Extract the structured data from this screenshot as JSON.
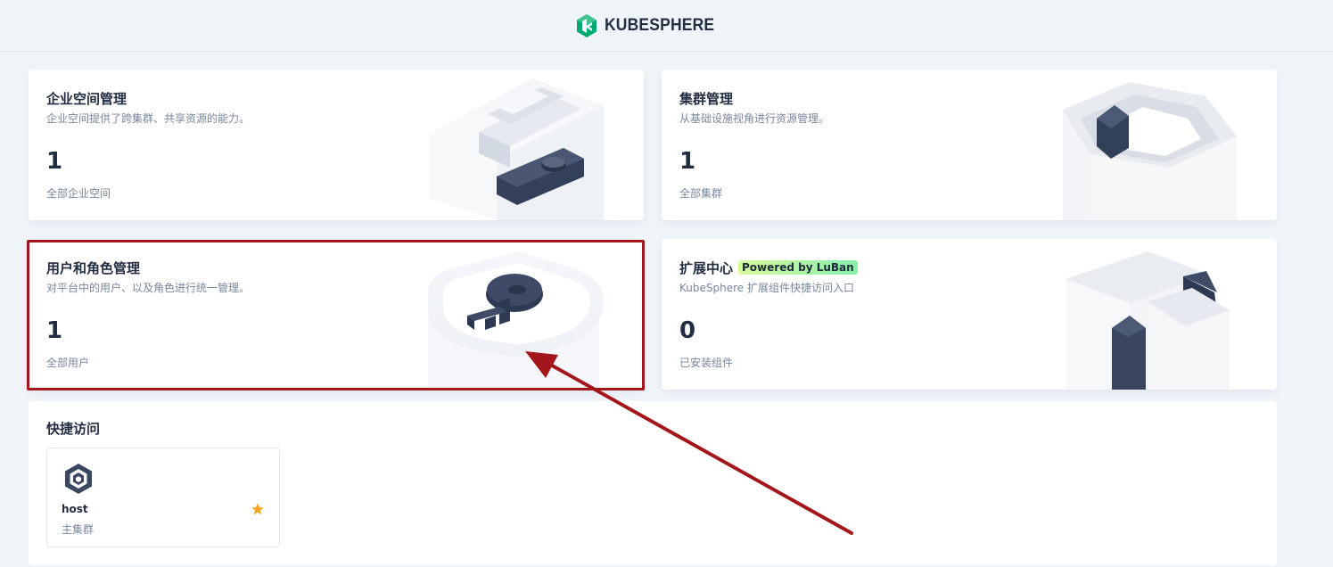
{
  "header": {
    "brand": "KUBESPHERE",
    "logo_icon": "kubesphere-logo-icon"
  },
  "cards": {
    "workspace": {
      "title": "企业空间管理",
      "desc": "企业空间提供了跨集群、共享资源的能力。",
      "count": "1",
      "sub": "全部企业空间"
    },
    "cluster": {
      "title": "集群管理",
      "desc": "从基础设施视角进行资源管理。",
      "count": "1",
      "sub": "全部集群"
    },
    "users": {
      "title": "用户和角色管理",
      "desc": "对平台中的用户、以及角色进行统一管理。",
      "count": "1",
      "sub": "全部用户"
    },
    "extensions": {
      "title": "扩展中心",
      "badge": "Powered by LuBan",
      "desc": "KubeSphere 扩展组件快捷访问入口",
      "count": "0",
      "sub": "已安装组件"
    }
  },
  "quick_access": {
    "title": "快捷访问",
    "clusters": [
      {
        "name": "host",
        "role": "主集群",
        "icon": "cluster-icon",
        "favorite": true
      }
    ]
  },
  "colors": {
    "background": "#eff4f9",
    "text_primary": "#242e42",
    "text_secondary": "#79879c",
    "brand_green": "#00a971",
    "annotation_red": "#a3161b",
    "star": "#f5a623"
  }
}
